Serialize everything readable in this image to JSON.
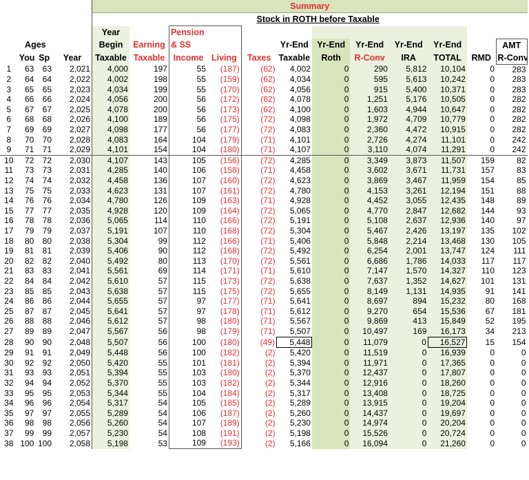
{
  "summary_title": "Summary",
  "subtitle": "Stock in ROTH before Taxable",
  "headers": {
    "ages": "Ages",
    "you": "You",
    "sp": "Sp",
    "year": "Year",
    "begin_taxable_1": "Year",
    "begin_taxable_2": "Begin",
    "begin_taxable_3": "Taxable",
    "earning_1": "Earning",
    "earning_2": "Taxable",
    "pension_1": "Pension",
    "pension_2": "& SS",
    "pension_3": "Income",
    "living": "Living",
    "taxes": "Taxes",
    "yrend_taxable_1": "Yr-End",
    "yrend_taxable_2": "Taxable",
    "yrend_roth_1": "Yr-End",
    "yrend_roth_2": "Roth",
    "yrend_rconv_1": "Yr-End",
    "yrend_rconv_2": "R-Conv",
    "yrend_ira_1": "Yr-End",
    "yrend_ira_2": "IRA",
    "yrend_total_1": "Yr-End",
    "yrend_total_2": "TOTAL",
    "rmd": "RMD",
    "amt_1": "AMT",
    "amt_2": "R-Conv"
  },
  "rows": [
    [
      "1",
      "63",
      "63",
      "2,021",
      "4,000",
      "197",
      "55",
      "(187)",
      "(62)",
      "4,002",
      "0",
      "290",
      "5,812",
      "10,104",
      "0",
      "283"
    ],
    [
      "2",
      "64",
      "64",
      "2,022",
      "4,002",
      "198",
      "55",
      "(159)",
      "(62)",
      "4,034",
      "0",
      "595",
      "5,613",
      "10,242",
      "0",
      "283"
    ],
    [
      "3",
      "65",
      "65",
      "2,023",
      "4,034",
      "199",
      "55",
      "(170)",
      "(62)",
      "4,056",
      "0",
      "915",
      "5,400",
      "10,371",
      "0",
      "283"
    ],
    [
      "4",
      "66",
      "66",
      "2,024",
      "4,056",
      "200",
      "56",
      "(172)",
      "(62)",
      "4,078",
      "0",
      "1,251",
      "5,176",
      "10,505",
      "0",
      "282"
    ],
    [
      "5",
      "67",
      "67",
      "2,025",
      "4,078",
      "200",
      "56",
      "(173)",
      "(62)",
      "4,100",
      "0",
      "1,603",
      "4,944",
      "10,647",
      "0",
      "282"
    ],
    [
      "6",
      "68",
      "68",
      "2,026",
      "4,100",
      "189",
      "56",
      "(175)",
      "(72)",
      "4,098",
      "0",
      "1,972",
      "4,709",
      "10,779",
      "0",
      "282"
    ],
    [
      "7",
      "69",
      "69",
      "2,027",
      "4,098",
      "177",
      "56",
      "(177)",
      "(72)",
      "4,083",
      "0",
      "2,360",
      "4,472",
      "10,915",
      "0",
      "282"
    ],
    [
      "8",
      "70",
      "70",
      "2,028",
      "4,083",
      "164",
      "104",
      "(179)",
      "(71)",
      "4,101",
      "0",
      "2,726",
      "4,274",
      "11,101",
      "0",
      "242"
    ],
    [
      "9",
      "71",
      "71",
      "2,029",
      "4,101",
      "154",
      "104",
      "(180)",
      "(71)",
      "4,107",
      "0",
      "3,110",
      "4,074",
      "11,291",
      "0",
      "242"
    ],
    [
      "10",
      "72",
      "72",
      "2,030",
      "4,107",
      "143",
      "105",
      "(156)",
      "(72)",
      "4,285",
      "0",
      "3,349",
      "3,873",
      "11,507",
      "159",
      "82"
    ],
    [
      "11",
      "73",
      "73",
      "2,031",
      "4,285",
      "140",
      "106",
      "(158)",
      "(71)",
      "4,458",
      "0",
      "3,602",
      "3,671",
      "11,731",
      "157",
      "83"
    ],
    [
      "12",
      "74",
      "74",
      "2,032",
      "4,458",
      "136",
      "107",
      "(160)",
      "(72)",
      "4,623",
      "0",
      "3,869",
      "3,467",
      "11,959",
      "154",
      "85"
    ],
    [
      "13",
      "75",
      "75",
      "2,033",
      "4,623",
      "131",
      "107",
      "(161)",
      "(72)",
      "4,780",
      "0",
      "4,153",
      "3,261",
      "12,194",
      "151",
      "88"
    ],
    [
      "14",
      "76",
      "76",
      "2,034",
      "4,780",
      "126",
      "109",
      "(163)",
      "(71)",
      "4,928",
      "0",
      "4,452",
      "3,055",
      "12,435",
      "148",
      "89"
    ],
    [
      "15",
      "77",
      "77",
      "2,035",
      "4,928",
      "120",
      "109",
      "(164)",
      "(72)",
      "5,065",
      "0",
      "4,770",
      "2,847",
      "12,682",
      "144",
      "93"
    ],
    [
      "16",
      "78",
      "78",
      "2,036",
      "5,065",
      "114",
      "110",
      "(166)",
      "(72)",
      "5,191",
      "0",
      "5,108",
      "2,637",
      "12,936",
      "140",
      "97"
    ],
    [
      "17",
      "79",
      "79",
      "2,037",
      "5,191",
      "107",
      "110",
      "(168)",
      "(72)",
      "5,304",
      "0",
      "5,467",
      "2,426",
      "13,197",
      "135",
      "102"
    ],
    [
      "18",
      "80",
      "80",
      "2,038",
      "5,304",
      "99",
      "112",
      "(166)",
      "(71)",
      "5,406",
      "0",
      "5,848",
      "2,214",
      "13,468",
      "130",
      "105"
    ],
    [
      "19",
      "81",
      "81",
      "2,039",
      "5,406",
      "90",
      "112",
      "(168)",
      "(72)",
      "5,492",
      "0",
      "6,254",
      "2,001",
      "13,747",
      "124",
      "111"
    ],
    [
      "20",
      "82",
      "82",
      "2,040",
      "5,492",
      "80",
      "113",
      "(170)",
      "(72)",
      "5,561",
      "0",
      "6,686",
      "1,786",
      "14,033",
      "117",
      "117"
    ],
    [
      "21",
      "83",
      "83",
      "2,041",
      "5,561",
      "69",
      "114",
      "(171)",
      "(71)",
      "5,610",
      "0",
      "7,147",
      "1,570",
      "14,327",
      "110",
      "123"
    ],
    [
      "22",
      "84",
      "84",
      "2,042",
      "5,610",
      "57",
      "115",
      "(173)",
      "(72)",
      "5,638",
      "0",
      "7,637",
      "1,352",
      "14,627",
      "101",
      "131"
    ],
    [
      "23",
      "85",
      "85",
      "2,043",
      "5,638",
      "57",
      "115",
      "(175)",
      "(72)",
      "5,655",
      "0",
      "8,149",
      "1,131",
      "14,935",
      "91",
      "141"
    ],
    [
      "24",
      "86",
      "86",
      "2,044",
      "5,655",
      "57",
      "97",
      "(177)",
      "(71)",
      "5,641",
      "0",
      "8,697",
      "894",
      "15,232",
      "80",
      "168"
    ],
    [
      "25",
      "87",
      "87",
      "2,045",
      "5,641",
      "57",
      "97",
      "(178)",
      "(71)",
      "5,612",
      "0",
      "9,270",
      "654",
      "15,536",
      "67",
      "181"
    ],
    [
      "26",
      "88",
      "88",
      "2,046",
      "5,612",
      "57",
      "98",
      "(180)",
      "(71)",
      "5,567",
      "0",
      "9,869",
      "413",
      "15,849",
      "52",
      "195"
    ],
    [
      "27",
      "89",
      "89",
      "2,047",
      "5,567",
      "56",
      "98",
      "(179)",
      "(71)",
      "5,507",
      "0",
      "10,497",
      "169",
      "16,173",
      "34",
      "213"
    ],
    [
      "28",
      "90",
      "90",
      "2,048",
      "5,507",
      "56",
      "100",
      "(180)",
      "(49)",
      "5,448",
      "0",
      "11,079",
      "0",
      "16,527",
      "15",
      "154"
    ],
    [
      "29",
      "91",
      "91",
      "2,049",
      "5,448",
      "56",
      "100",
      "(182)",
      "(2)",
      "5,420",
      "0",
      "11,519",
      "0",
      "16,939",
      "0",
      "0"
    ],
    [
      "30",
      "92",
      "92",
      "2,050",
      "5,420",
      "55",
      "101",
      "(181)",
      "(2)",
      "5,394",
      "0",
      "11,971",
      "0",
      "17,365",
      "0",
      "0"
    ],
    [
      "31",
      "93",
      "93",
      "2,051",
      "5,394",
      "55",
      "103",
      "(180)",
      "(2)",
      "5,370",
      "0",
      "12,437",
      "0",
      "17,807",
      "0",
      "0"
    ],
    [
      "32",
      "94",
      "94",
      "2,052",
      "5,370",
      "55",
      "103",
      "(182)",
      "(2)",
      "5,344",
      "0",
      "12,916",
      "0",
      "18,260",
      "0",
      "0"
    ],
    [
      "33",
      "95",
      "95",
      "2,053",
      "5,344",
      "55",
      "104",
      "(184)",
      "(2)",
      "5,317",
      "0",
      "13,408",
      "0",
      "18,725",
      "0",
      "0"
    ],
    [
      "34",
      "96",
      "96",
      "2,054",
      "5,317",
      "54",
      "105",
      "(185)",
      "(2)",
      "5,289",
      "0",
      "13,915",
      "0",
      "19,204",
      "0",
      "0"
    ],
    [
      "35",
      "97",
      "97",
      "2,055",
      "5,289",
      "54",
      "106",
      "(187)",
      "(2)",
      "5,260",
      "0",
      "14,437",
      "0",
      "19,697",
      "0",
      "0"
    ],
    [
      "36",
      "98",
      "98",
      "2,056",
      "5,260",
      "54",
      "107",
      "(189)",
      "(2)",
      "5,230",
      "0",
      "14,974",
      "0",
      "20,204",
      "0",
      "0"
    ],
    [
      "37",
      "99",
      "99",
      "2,057",
      "5,230",
      "54",
      "108",
      "(191)",
      "(2)",
      "5,198",
      "0",
      "15,526",
      "0",
      "20,724",
      "0",
      "0"
    ],
    [
      "38",
      "100",
      "100",
      "2,058",
      "5,198",
      "53",
      "109",
      "(193)",
      "(2)",
      "5,166",
      "0",
      "16,094",
      "0",
      "21,260",
      "0",
      "0"
    ]
  ],
  "colors": {
    "header_green": "#d8e4bc",
    "light_green": "#ebf1de",
    "red": "#e03030"
  }
}
